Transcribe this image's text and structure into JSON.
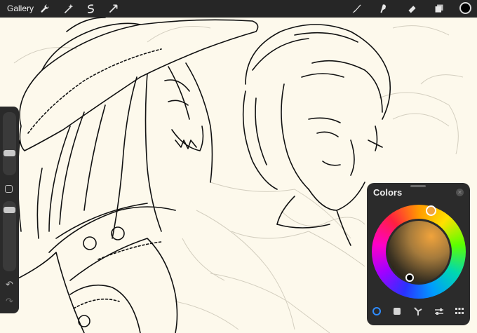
{
  "topbar": {
    "gallery_label": "Gallery",
    "left_tools": [
      "wrench-icon",
      "magic-wand-icon",
      "selection-icon",
      "transform-icon"
    ],
    "right_tools": [
      "brush-icon",
      "smudge-icon",
      "eraser-icon",
      "layers-icon"
    ],
    "current_color": "#000000"
  },
  "sidebar": {
    "brush_size_level": 0.5,
    "opacity_level": 0.9
  },
  "colors_panel": {
    "title": "Colors",
    "selected_hue_color": "#f0a33c",
    "selected_color": "#000000",
    "modes": [
      "disc-icon",
      "classic-icon",
      "harmony-icon",
      "value-icon",
      "palettes-icon"
    ],
    "active_mode": "disc-icon"
  },
  "colors": {
    "canvas": "#fdf9ec",
    "chrome": "#262626",
    "ink": "#111111",
    "sketch": "#c9c4b6"
  }
}
